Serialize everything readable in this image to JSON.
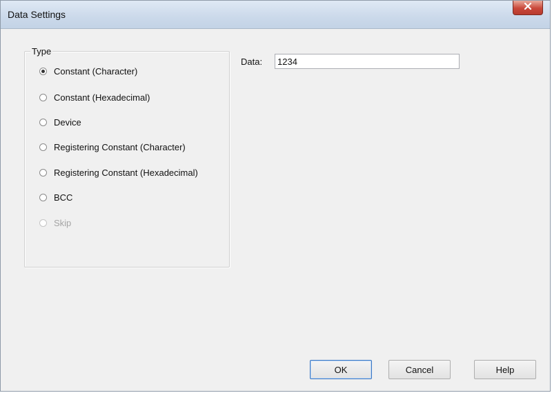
{
  "window": {
    "title": "Data Settings",
    "close_glyph": "✕"
  },
  "type_group": {
    "label": "Type",
    "options": [
      {
        "label": "Constant (Character)",
        "checked": true,
        "disabled": false
      },
      {
        "label": "Constant (Hexadecimal)",
        "checked": false,
        "disabled": false
      },
      {
        "label": "Device",
        "checked": false,
        "disabled": false
      },
      {
        "label": "Registering Constant (Character)",
        "checked": false,
        "disabled": false
      },
      {
        "label": "Registering Constant (Hexadecimal)",
        "checked": false,
        "disabled": false
      },
      {
        "label": "BCC",
        "checked": false,
        "disabled": false
      },
      {
        "label": "Skip",
        "checked": false,
        "disabled": true
      }
    ]
  },
  "data_field": {
    "label": "Data:",
    "value": "1234"
  },
  "buttons": {
    "ok": "OK",
    "cancel": "Cancel",
    "help": "Help"
  }
}
